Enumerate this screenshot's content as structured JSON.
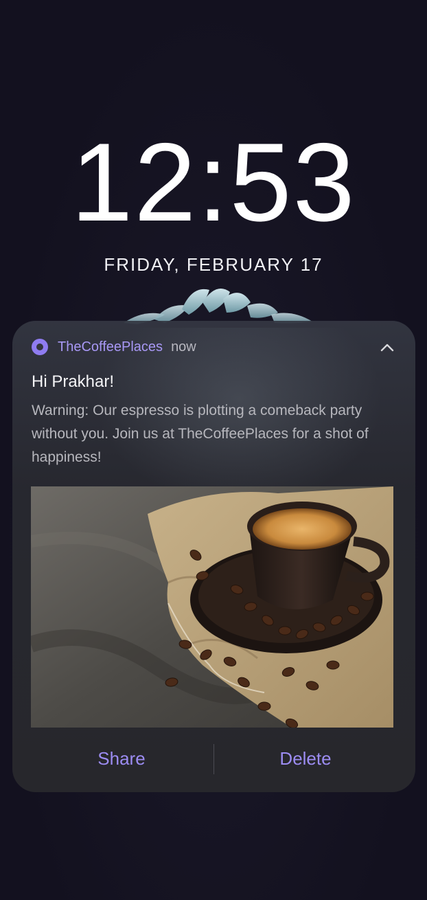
{
  "lock_screen": {
    "time": "12:53",
    "date": "FRIDAY, FEBRUARY 17"
  },
  "notification": {
    "app_name": "TheCoffeePlaces",
    "time": "now",
    "app_icon": "app-ring-icon",
    "collapse_icon": "chevron-up-icon",
    "title": "Hi Prakhar!",
    "body": "Warning: Our espresso is plotting a comeback party without you. Join us at TheCoffeePlaces for a shot of happiness!",
    "image": "espresso-cup-with-coffee-beans-image",
    "actions": {
      "share": "Share",
      "delete": "Delete"
    }
  },
  "colors": {
    "background": "#13111f",
    "card": "#2a2a30",
    "accent": "#9c8cf2",
    "app_name": "#a898f5",
    "body_text": "#b7b7bd"
  }
}
